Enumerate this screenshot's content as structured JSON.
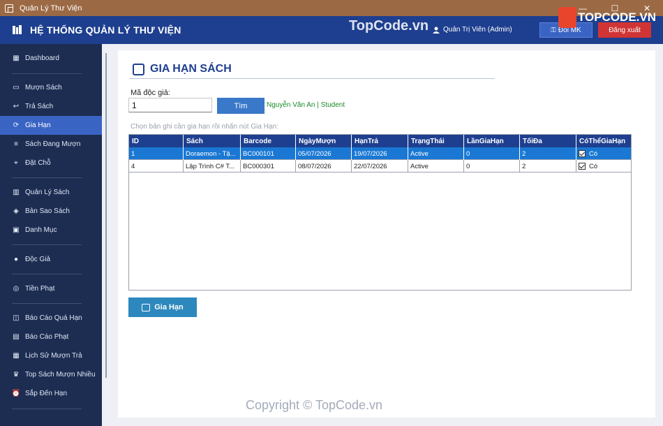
{
  "window": {
    "title": "Quản Lý Thư Viện",
    "controls": [
      "—",
      "☐",
      "✕"
    ]
  },
  "header": {
    "title": "HỆ THỐNG QUẢN LÝ THƯ VIỆN",
    "watermark": "TopCode.vn",
    "user": "Quản Trị Viên  (Admin)",
    "change_password": "Đổi MK",
    "logout": "Đăng xuất",
    "logo_text": "TOPCODE.VN"
  },
  "sidebar": {
    "items": [
      {
        "label": "Dashboard",
        "icon": "chart-icon"
      },
      {
        "label": "Mượn Sách",
        "icon": "book-icon"
      },
      {
        "label": "Trả Sách",
        "icon": "return-icon"
      },
      {
        "label": "Gia Hạn",
        "icon": "renew-icon",
        "active": true
      },
      {
        "label": "Sách Đang Mượn",
        "icon": "list-icon"
      },
      {
        "label": "Đặt Chỗ",
        "icon": "pin-icon"
      },
      {
        "label": "Quản Lý Sách",
        "icon": "books-icon"
      },
      {
        "label": "Bản Sao Sách",
        "icon": "box-icon"
      },
      {
        "label": "Danh Mục",
        "icon": "calendar-icon"
      },
      {
        "label": "Độc Giả",
        "icon": "user-icon"
      },
      {
        "label": "Tiền Phạt",
        "icon": "coin-icon"
      },
      {
        "label": "Báo Cáo Quá Hạn",
        "icon": "report-icon"
      },
      {
        "label": "Báo Cáo Phạt",
        "icon": "report-icon"
      },
      {
        "label": "Lịch Sử Mượn Trả",
        "icon": "history-icon"
      },
      {
        "label": "Top Sách Mượn Nhiều",
        "icon": "trophy-icon"
      },
      {
        "label": "Sắp Đến Hạn",
        "icon": "alarm-icon"
      }
    ]
  },
  "page": {
    "title": "GIA HẠN SÁCH",
    "reader_label": "Mã độc giả:",
    "reader_value": "1",
    "search_button": "Tìm",
    "reader_info": "Nguyễn Văn An  |  Student",
    "hint": "Chọn bản ghi cần gia hạn rồi nhấn nút Gia Hạn:",
    "renew_button": "Gia Hạn"
  },
  "grid": {
    "columns": [
      "ID",
      "Sách",
      "Barcode",
      "NgàyMượn",
      "HạnTrả",
      "TrạngThái",
      "LầnGiaHạn",
      "TốiĐa",
      "CóThểGiaHạn"
    ],
    "rows": [
      [
        "1",
        "Doraemon - Tậ...",
        "BC000101",
        "05/07/2026",
        "19/07/2026",
        "Active",
        "0",
        "2",
        "Có"
      ],
      [
        "4",
        "Lập Trình C# T...",
        "BC000301",
        "08/07/2026",
        "22/07/2026",
        "Active",
        "0",
        "2",
        "Có"
      ]
    ]
  },
  "footer": {
    "copyright": "Copyright © TopCode.vn"
  },
  "colors": {
    "header": "#1e3f8f",
    "sidebar": "#1d2d52",
    "accent": "#3a64c4",
    "selected_row": "#1a78d4",
    "logout": "#d03434"
  }
}
